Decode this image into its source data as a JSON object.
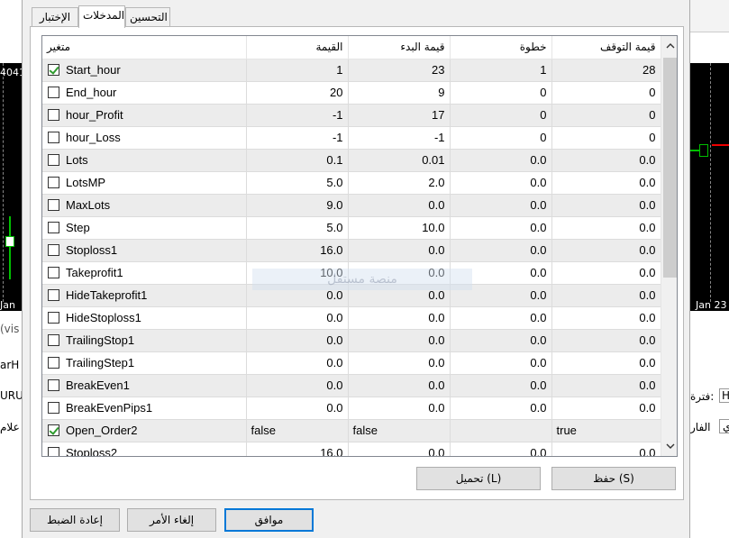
{
  "background": {
    "left_chart_price": "4041",
    "left_chart_date": "Jan",
    "left_frag_1": "(vis",
    "left_frag_2": "arH",
    "left_frag_3": "URU",
    "left_frag_4": "علام",
    "right_chart_date": "Jan 23",
    "right_frag_period": "فترة:",
    "right_frag_period_box": "H",
    "right_frag_spread": "الفار",
    "right_frag_spread_box": "ي"
  },
  "tabs": [
    {
      "label": "الإختبار"
    },
    {
      "label": "المدخلات"
    },
    {
      "label": "التحسين"
    }
  ],
  "table": {
    "headers": {
      "variable": "متغير",
      "value": "القيمة",
      "start": "قيمة البدء",
      "step": "خطوة",
      "stop": "قيمة التوقف"
    },
    "rows": [
      {
        "checked": true,
        "name": "Start_hour",
        "value": "1",
        "start": "23",
        "step": "1",
        "stop": "28"
      },
      {
        "checked": false,
        "name": "End_hour",
        "value": "20",
        "start": "9",
        "step": "0",
        "stop": "0"
      },
      {
        "checked": false,
        "name": "hour_Profit",
        "value": "-1",
        "start": "17",
        "step": "0",
        "stop": "0"
      },
      {
        "checked": false,
        "name": "hour_Loss",
        "value": "-1",
        "start": "-1",
        "step": "0",
        "stop": "0"
      },
      {
        "checked": false,
        "name": "Lots",
        "value": "0.1",
        "start": "0.01",
        "step": "0.0",
        "stop": "0.0"
      },
      {
        "checked": false,
        "name": "LotsMP",
        "value": "5.0",
        "start": "2.0",
        "step": "0.0",
        "stop": "0.0"
      },
      {
        "checked": false,
        "name": "MaxLots",
        "value": "9.0",
        "start": "0.0",
        "step": "0.0",
        "stop": "0.0"
      },
      {
        "checked": false,
        "name": "Step",
        "value": "5.0",
        "start": "10.0",
        "step": "0.0",
        "stop": "0.0"
      },
      {
        "checked": false,
        "name": "Stoploss1",
        "value": "16.0",
        "start": "0.0",
        "step": "0.0",
        "stop": "0.0"
      },
      {
        "checked": false,
        "name": "Takeprofit1",
        "value": "10.0",
        "start": "0.0",
        "step": "0.0",
        "stop": "0.0"
      },
      {
        "checked": false,
        "name": "HideTakeprofit1",
        "value": "0.0",
        "start": "0.0",
        "step": "0.0",
        "stop": "0.0"
      },
      {
        "checked": false,
        "name": "HideStoploss1",
        "value": "0.0",
        "start": "0.0",
        "step": "0.0",
        "stop": "0.0"
      },
      {
        "checked": false,
        "name": "TrailingStop1",
        "value": "0.0",
        "start": "0.0",
        "step": "0.0",
        "stop": "0.0"
      },
      {
        "checked": false,
        "name": "TrailingStep1",
        "value": "0.0",
        "start": "0.0",
        "step": "0.0",
        "stop": "0.0"
      },
      {
        "checked": false,
        "name": "BreakEven1",
        "value": "0.0",
        "start": "0.0",
        "step": "0.0",
        "stop": "0.0"
      },
      {
        "checked": false,
        "name": "BreakEvenPips1",
        "value": "0.0",
        "start": "0.0",
        "step": "0.0",
        "stop": "0.0"
      },
      {
        "checked": true,
        "name": "Open_Order2",
        "value": "false",
        "start": "false",
        "step": "",
        "stop": "true"
      },
      {
        "checked": false,
        "name": "Stoploss2",
        "value": "16.0",
        "start": "0.0",
        "step": "0.0",
        "stop": "0.0"
      }
    ]
  },
  "watermark": "منصة مستقل",
  "buttons": {
    "load": "تحميل (L)",
    "save": "حفظ (S)",
    "reset": "إعادة الضبط",
    "cancel": "إلغاء الأمر",
    "ok": "موافق"
  },
  "scroll_up_icon": "chevron-up",
  "scroll_down_icon": "chevron-down"
}
